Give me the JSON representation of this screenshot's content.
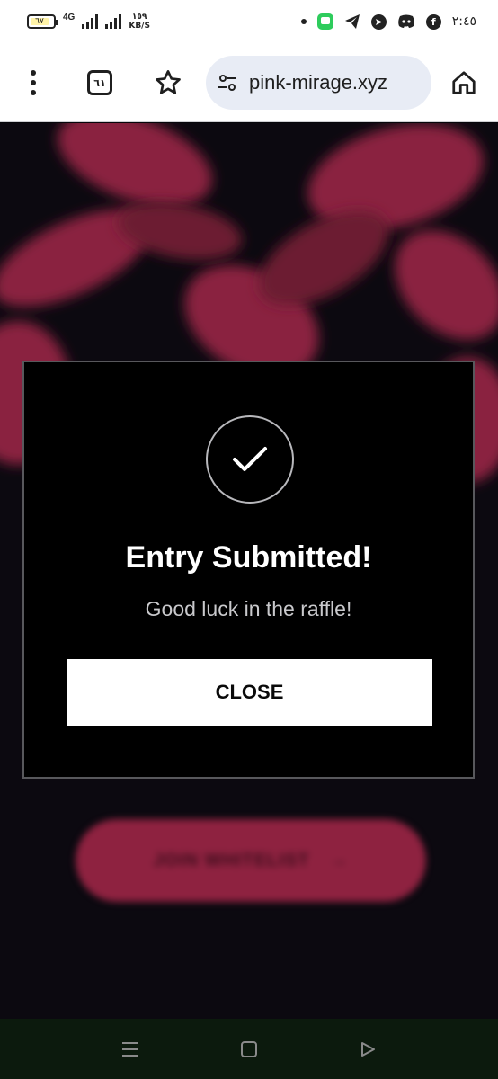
{
  "status_bar": {
    "battery_level": "٦٧",
    "network_type": "4G",
    "speed_value": "١٥٩",
    "speed_unit": "KB/S",
    "time": "٢:٤٥",
    "icons": [
      "notification-dot-icon",
      "chat-app-icon",
      "telegram-icon",
      "messenger-icon",
      "discord-icon",
      "facebook-icon"
    ]
  },
  "browser": {
    "tab_count": "٦١",
    "url": "pink-mirage.xyz",
    "icons": [
      "more-options-icon",
      "tab-switcher-icon",
      "bookmark-star-icon",
      "site-settings-icon",
      "home-icon"
    ]
  },
  "page": {
    "background_cta_label": "JOIN WHITELIST",
    "background_cta_arrow": "→",
    "accent_color": "#8e2240"
  },
  "modal": {
    "title": "Entry Submitted!",
    "message": "Good luck in the raffle!",
    "close_label": "CLOSE",
    "icon": "checkmark-icon"
  },
  "nav_bar": {
    "icons": [
      "recents-menu-icon",
      "home-square-icon",
      "back-triangle-icon"
    ]
  }
}
